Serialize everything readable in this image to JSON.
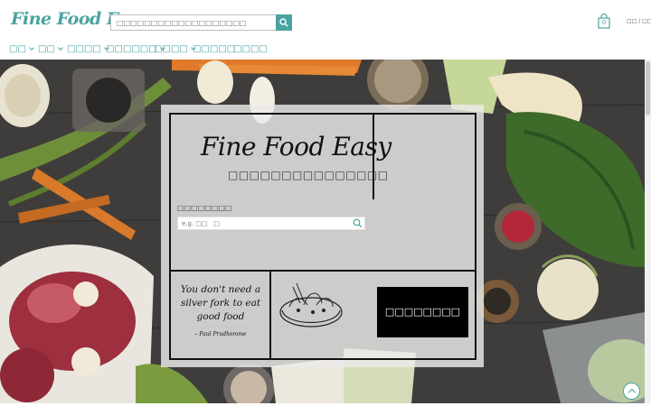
{
  "brand": {
    "logo_text": "Fine Food Easy",
    "accent_color": "#4aa3a0"
  },
  "header": {
    "search": {
      "placeholder": "□□□□□□□□□□□□□□□□□□□",
      "icon": "search-icon"
    },
    "cart": {
      "count": "0",
      "icon": "shopping-bag-icon"
    },
    "language": "□□ / □□"
  },
  "nav": {
    "items": [
      {
        "label": "□□",
        "has_dropdown": true
      },
      {
        "label": "□□",
        "has_dropdown": true
      },
      {
        "label": "□□□□",
        "has_dropdown": true
      },
      {
        "label": "□□□□□□",
        "has_dropdown": true
      },
      {
        "label": "□□□□",
        "has_dropdown": true
      },
      {
        "label": "□□□□□",
        "has_dropdown": false
      },
      {
        "label": "□□□□",
        "has_dropdown": false
      }
    ]
  },
  "hero_card": {
    "logo_text": "Fine Food Easy",
    "subtitle": "□□□□□□□□□□□□□□□",
    "search_label": "□□□□□□□□",
    "search_placeholder": "e.g. □□   □",
    "quote": "You don't need a silver fork to eat good food",
    "quote_author": "– Paul Prudhomme",
    "cta_label": "□□□□□□□□"
  }
}
